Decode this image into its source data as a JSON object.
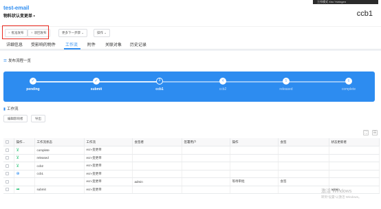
{
  "header": {
    "title": "test-email",
    "subtitle": "物料状认变更单 •",
    "code": "ccb1",
    "user_chip": "工作模式 Xiro Yshingen"
  },
  "toolbar": {
    "btn_publish": "批准发布",
    "btn_reject": "驳回发布",
    "btn_dropdown": "更多下一步骤",
    "btn_ops": "操作"
  },
  "tabs": [
    "详细信息",
    "受影响的物件",
    "工作流",
    "附件",
    "关联对象",
    "历史记录"
  ],
  "active_tab": "工作流",
  "flow": {
    "section_title": "发布流程一览",
    "nodes": [
      {
        "label": "pending",
        "status": "done",
        "mark": "✓"
      },
      {
        "label": "submit",
        "status": "done",
        "mark": "✓"
      },
      {
        "label": "ccb1",
        "status": "current",
        "mark": "3"
      },
      {
        "label": "ccb2",
        "status": "todo",
        "mark": "4"
      },
      {
        "label": "released",
        "status": "todo",
        "mark": "5"
      },
      {
        "label": "complete",
        "status": "todo",
        "mark": "6"
      }
    ]
  },
  "workflow": {
    "section_title": "工作流",
    "btn_edit": "编辑影响者",
    "btn_export": "导出",
    "icon_expand": "⛶",
    "icon_grid": "☷",
    "columns": [
      "操作...",
      "工作流状态",
      "工作流",
      "会签者",
      "签署用户",
      "操作",
      "会签",
      "状态更新者"
    ],
    "rows": [
      {
        "icon": "branch",
        "status": "complete",
        "workflow": "ecn-变更单",
        "signer": "",
        "sign_user": "",
        "op": "",
        "sign": "",
        "updater": ""
      },
      {
        "icon": "branch",
        "status": "released",
        "workflow": "ecn-变更单",
        "signer": "",
        "sign_user": "",
        "op": "",
        "sign": "",
        "updater": ""
      },
      {
        "icon": "branch",
        "status": "ccb2",
        "workflow": "ecn-变更单",
        "signer": "",
        "sign_user": "",
        "op": "",
        "sign": "",
        "updater": ""
      },
      {
        "icon": "target",
        "status": "ccb1",
        "workflow": "ecn-变更单",
        "signer": "",
        "sign_user": "",
        "op": "",
        "sign": "",
        "updater": ""
      },
      {
        "icon": "",
        "status": "",
        "workflow": "ecn-变更单",
        "signer": "admin",
        "sign_user": "",
        "op": "等待审批",
        "sign": "会签",
        "updater": ""
      },
      {
        "icon": "arrow",
        "status": "submit",
        "workflow": "ecn-变更单",
        "signer": "",
        "sign_user": "",
        "op": "",
        "sign": "",
        "updater": "admin"
      }
    ]
  },
  "watermark": {
    "line1": "激活 Windows",
    "line2": "转到“设置”以激活 Windows。"
  },
  "colors": {
    "primary": "#2d8cf0",
    "highlight": "#e8281e",
    "success": "#19be6b"
  }
}
